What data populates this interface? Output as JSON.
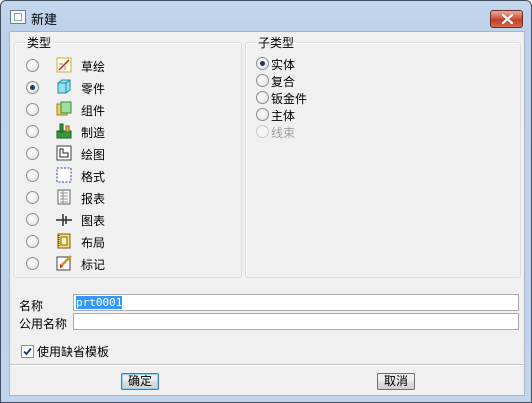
{
  "window": {
    "title": "新建"
  },
  "type_group": {
    "legend": "类型",
    "items": [
      {
        "label": "草绘",
        "icon": "sketch-icon",
        "selected": false
      },
      {
        "label": "零件",
        "icon": "part-icon",
        "selected": true
      },
      {
        "label": "组件",
        "icon": "assembly-icon",
        "selected": false
      },
      {
        "label": "制造",
        "icon": "manufacturing-icon",
        "selected": false
      },
      {
        "label": "绘图",
        "icon": "drawing-icon",
        "selected": false
      },
      {
        "label": "格式",
        "icon": "format-icon",
        "selected": false
      },
      {
        "label": "报表",
        "icon": "report-icon",
        "selected": false
      },
      {
        "label": "图表",
        "icon": "diagram-icon",
        "selected": false
      },
      {
        "label": "布局",
        "icon": "layout-icon",
        "selected": false
      },
      {
        "label": "标记",
        "icon": "markup-icon",
        "selected": false
      }
    ]
  },
  "subtype_group": {
    "legend": "子类型",
    "items": [
      {
        "label": "实体",
        "selected": true,
        "disabled": false
      },
      {
        "label": "复合",
        "selected": false,
        "disabled": false
      },
      {
        "label": "钣金件",
        "selected": false,
        "disabled": false
      },
      {
        "label": "主体",
        "selected": false,
        "disabled": false
      },
      {
        "label": "线束",
        "selected": false,
        "disabled": true
      }
    ]
  },
  "fields": {
    "name_label": "名称",
    "name_value": "prt0001",
    "common_name_label": "公用名称",
    "common_name_value": ""
  },
  "use_default_template": {
    "label": "使用缺省模板",
    "checked": true
  },
  "buttons": {
    "ok": "确定",
    "cancel": "取消"
  }
}
